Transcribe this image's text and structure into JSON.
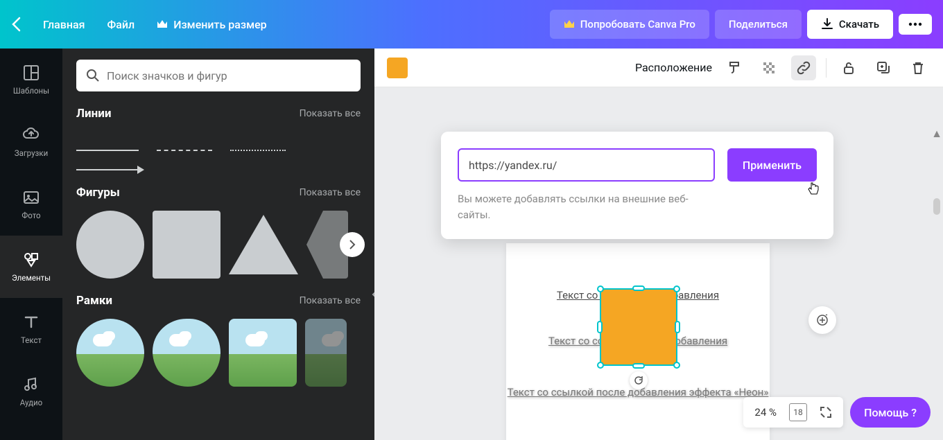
{
  "header": {
    "home": "Главная",
    "file": "Файл",
    "resize": "Изменить размер",
    "try_pro": "Попробовать Canva Pro",
    "share": "Поделиться",
    "download": "Скачать"
  },
  "rail": {
    "templates": "Шаблоны",
    "uploads": "Загрузки",
    "photos": "Фото",
    "elements": "Элементы",
    "text": "Текст",
    "audio": "Аудио"
  },
  "panel": {
    "search_placeholder": "Поиск значков и фигур",
    "lines": "Линии",
    "shapes": "Фигуры",
    "frames": "Рамки",
    "show_all": "Показать все"
  },
  "toolbar": {
    "position": "Расположение"
  },
  "link_popover": {
    "url_value": "https://yandex.ru/",
    "apply": "Применить",
    "hint": "Вы можете добавлять ссылки на внешние веб-сайты."
  },
  "canvas": {
    "text1": "Текст со ссылкой до добавления",
    "text2": "Текст со ссылкой после добавления",
    "text3": "Текст со ссылкой после добавления эффекта «Неон»"
  },
  "bottom": {
    "zoom": "24 %",
    "page_count": "18",
    "help": "Помощь  ?"
  }
}
